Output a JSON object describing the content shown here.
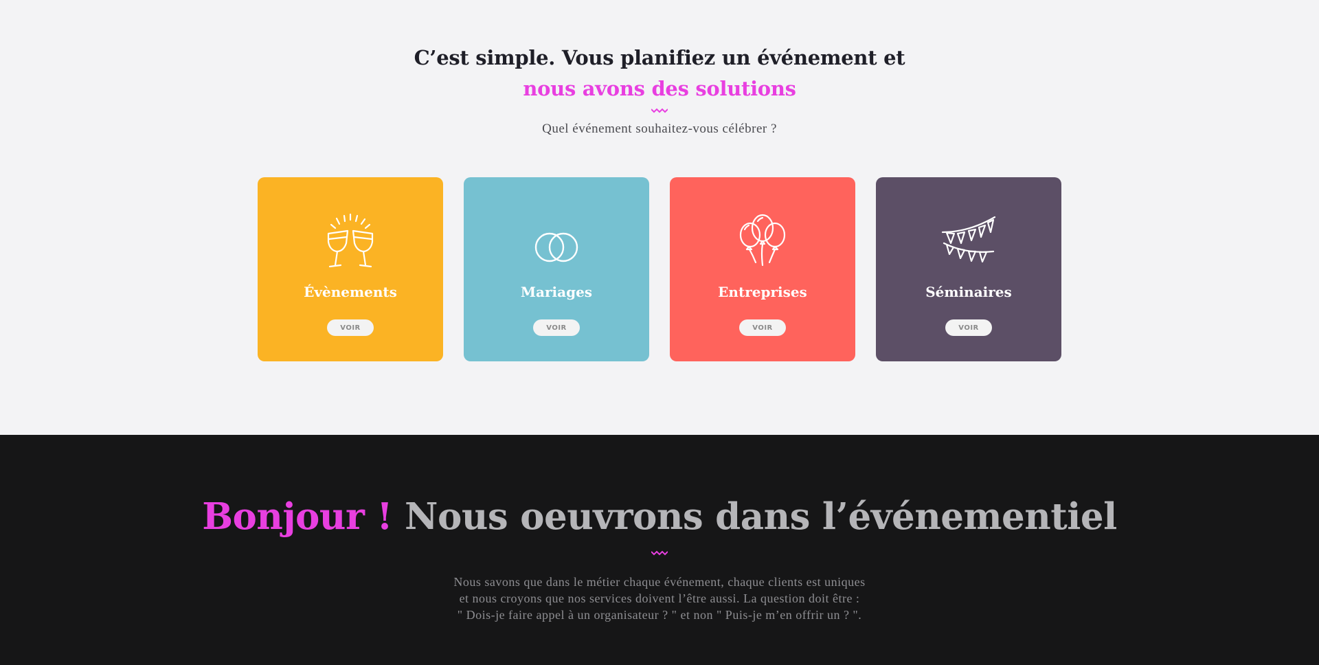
{
  "intro": {
    "heading_line1": "C’est simple. Vous planifiez un événement et",
    "heading_line2": "nous avons des solutions",
    "subtitle": "Quel événement souhaitez-vous célébrer ?"
  },
  "cards": [
    {
      "label": "Évènements",
      "button": "VOIR",
      "color": "#fbb324",
      "icon": "champagne-glasses-icon"
    },
    {
      "label": "Mariages",
      "button": "VOIR",
      "color": "#76c1d1",
      "icon": "wedding-rings-icon"
    },
    {
      "label": "Entreprises",
      "button": "VOIR",
      "color": "#ff635c",
      "icon": "balloons-icon"
    },
    {
      "label": "Séminaires",
      "button": "VOIR",
      "color": "#5c4f66",
      "icon": "bunting-flags-icon"
    }
  ],
  "about": {
    "greeting": "Bonjour !",
    "heading": "Nous oeuvrons dans l’événementiel",
    "paragraph_line1": "Nous savons que dans le métier chaque événement, chaque clients est uniques",
    "paragraph_line2": "et nous croyons que nos services doivent l’être aussi. La question doit être :",
    "paragraph_line3": "\" Dois-je faire appel à un organisateur ? \" et non \" Puis-je m’en offrir un ? \"."
  },
  "colors": {
    "accent": "#e83fe0",
    "light_bg": "#f3f3f5",
    "dark_bg": "#161617"
  }
}
